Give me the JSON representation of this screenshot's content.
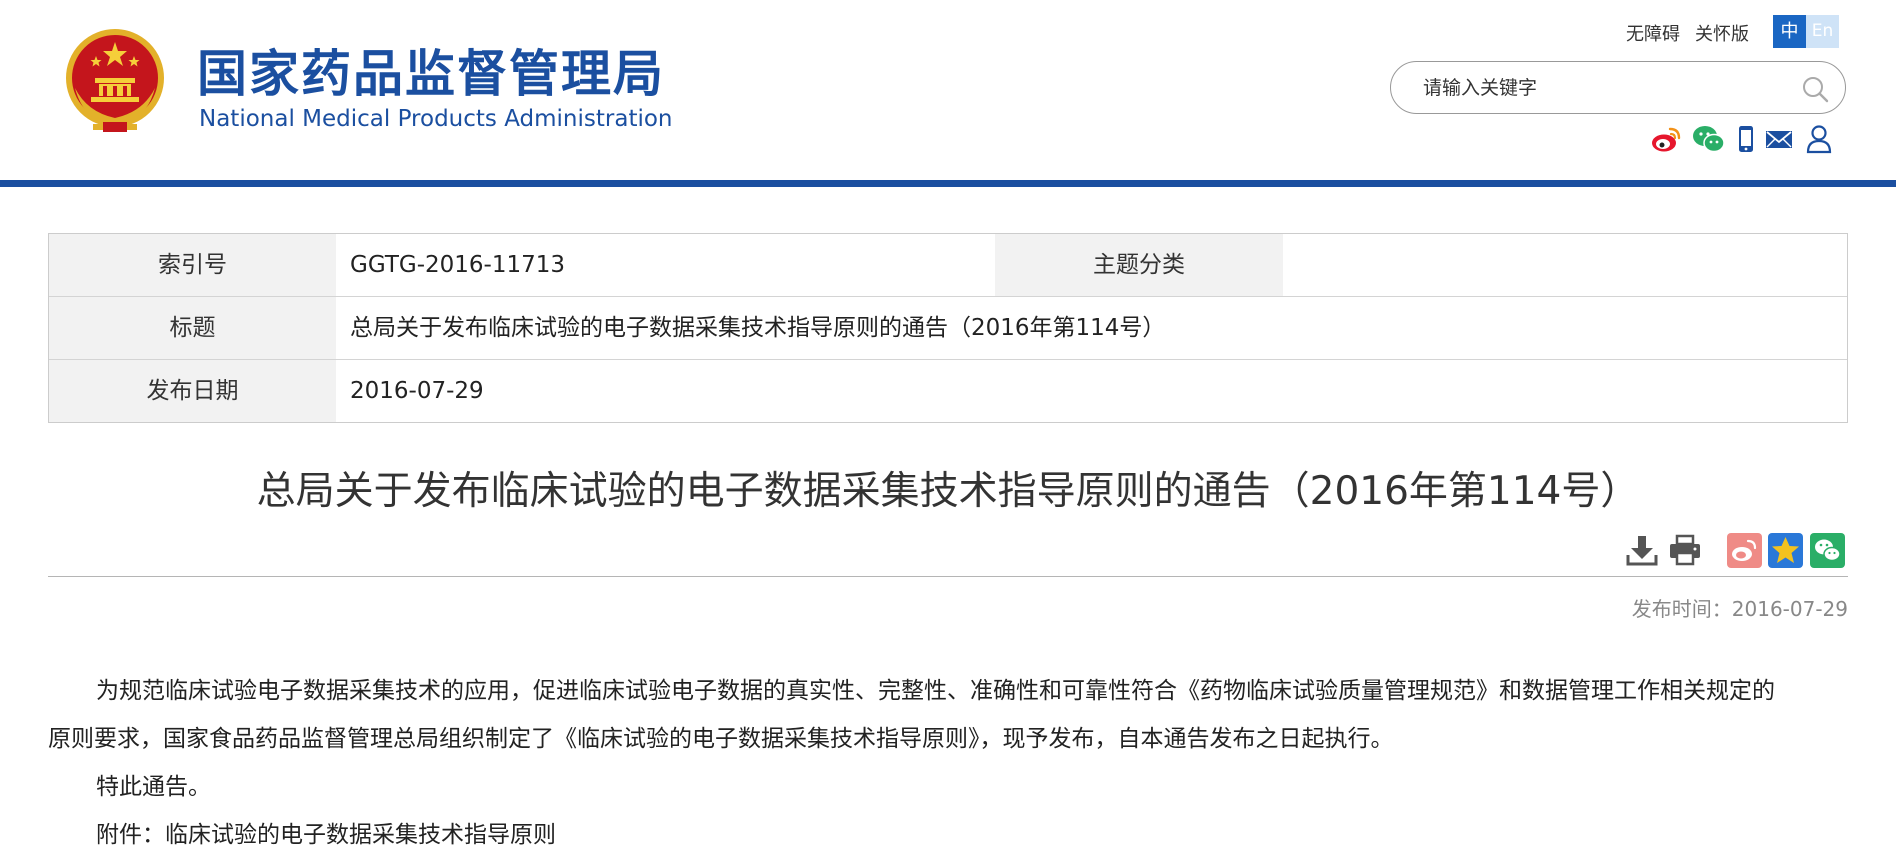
{
  "header": {
    "title_cn": "国家药品监督管理局",
    "title_en": "National Medical Products Administration",
    "links": {
      "accessibility": "无障碍",
      "care_version": "关怀版"
    },
    "language": {
      "zh": "中",
      "en": "En"
    },
    "search": {
      "placeholder": "请输入关键字"
    },
    "social_icons": [
      "weibo-icon",
      "wechat-icon",
      "mobile-icon",
      "mail-icon",
      "user-icon"
    ]
  },
  "info_table": {
    "index_label": "索引号",
    "index_value": "GGTG-2016-11713",
    "category_label": "主题分类",
    "category_value": "",
    "title_label": "标题",
    "title_value": "总局关于发布临床试验的电子数据采集技术指导原则的通告（2016年第114号）",
    "date_label": "发布日期",
    "date_value": "2016-07-29"
  },
  "article": {
    "title": "总局关于发布临床试验的电子数据采集技术指导原则的通告（2016年第114号）",
    "pub_time_label": "发布时间：",
    "pub_time_value": "2016-07-29",
    "line1": "为规范临床试验电子数据采集技术的应用，促进临床试验电子数据的真实性、完整性、准确性和可靠性符合《药物临床试验质量管理规范》和数据管理工作相关规定的",
    "line2": "原则要求，国家食品药品监督管理总局组织制定了《临床试验的电子数据采集技术指导原则》，现予发布，自本通告发布之日起执行。",
    "line3": "特此通告。",
    "line4": "附件：临床试验的电子数据采集技术指导原则"
  },
  "colors": {
    "brand_blue": "#1b4fa0",
    "lang_active": "#1a66c3",
    "weibo_red": "#e6162d",
    "wechat_green": "#2aae67",
    "star_orange": "#f3a91f"
  }
}
